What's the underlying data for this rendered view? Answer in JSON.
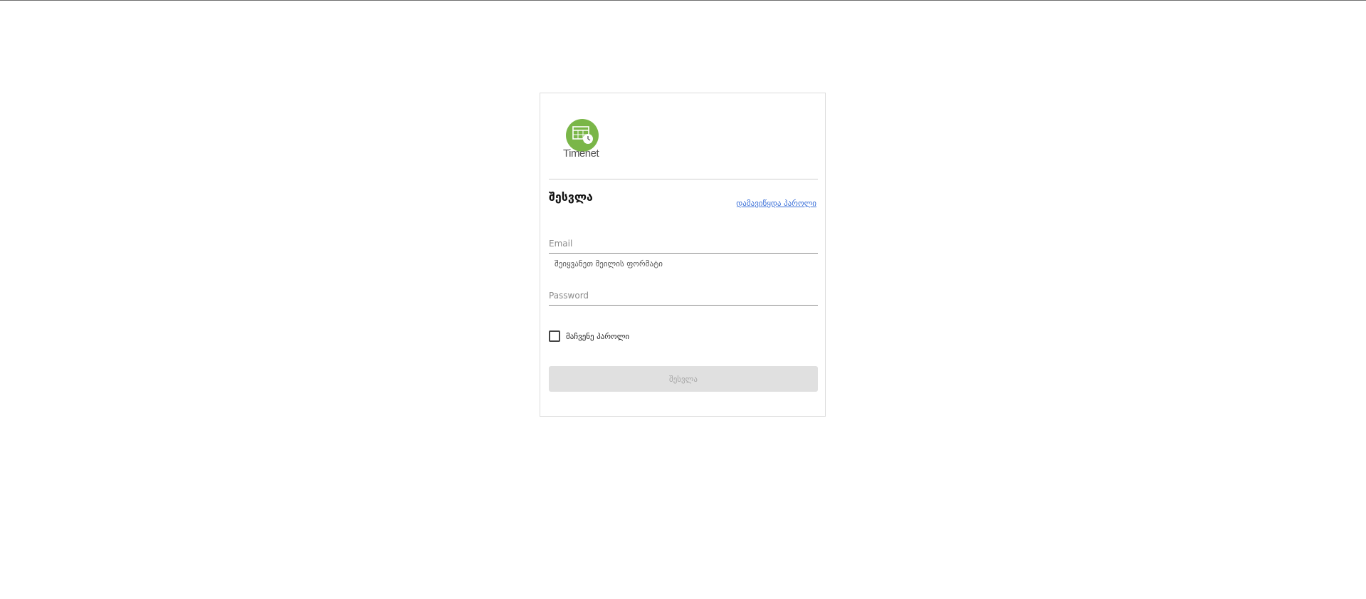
{
  "brand": {
    "logo_text": "Timenet",
    "accent_color": "#7ab648",
    "logo_icon": "calendar-clock-icon"
  },
  "login": {
    "title": "შესვლა",
    "forgot_password_link": "დამავიწყდა პაროლი",
    "email_placeholder": "Email",
    "email_value": "",
    "email_hint": "შეიყვანეთ მეილის ფორმატი",
    "password_placeholder": "Password",
    "password_value": "",
    "show_password_label": "მაჩვენე პაროლი",
    "show_password_checked": false,
    "submit_label": "შესვლა"
  },
  "colors": {
    "link": "#3a6fd8",
    "disabled_button_bg": "#e0e0e0",
    "disabled_button_text": "#a6a6a6"
  }
}
